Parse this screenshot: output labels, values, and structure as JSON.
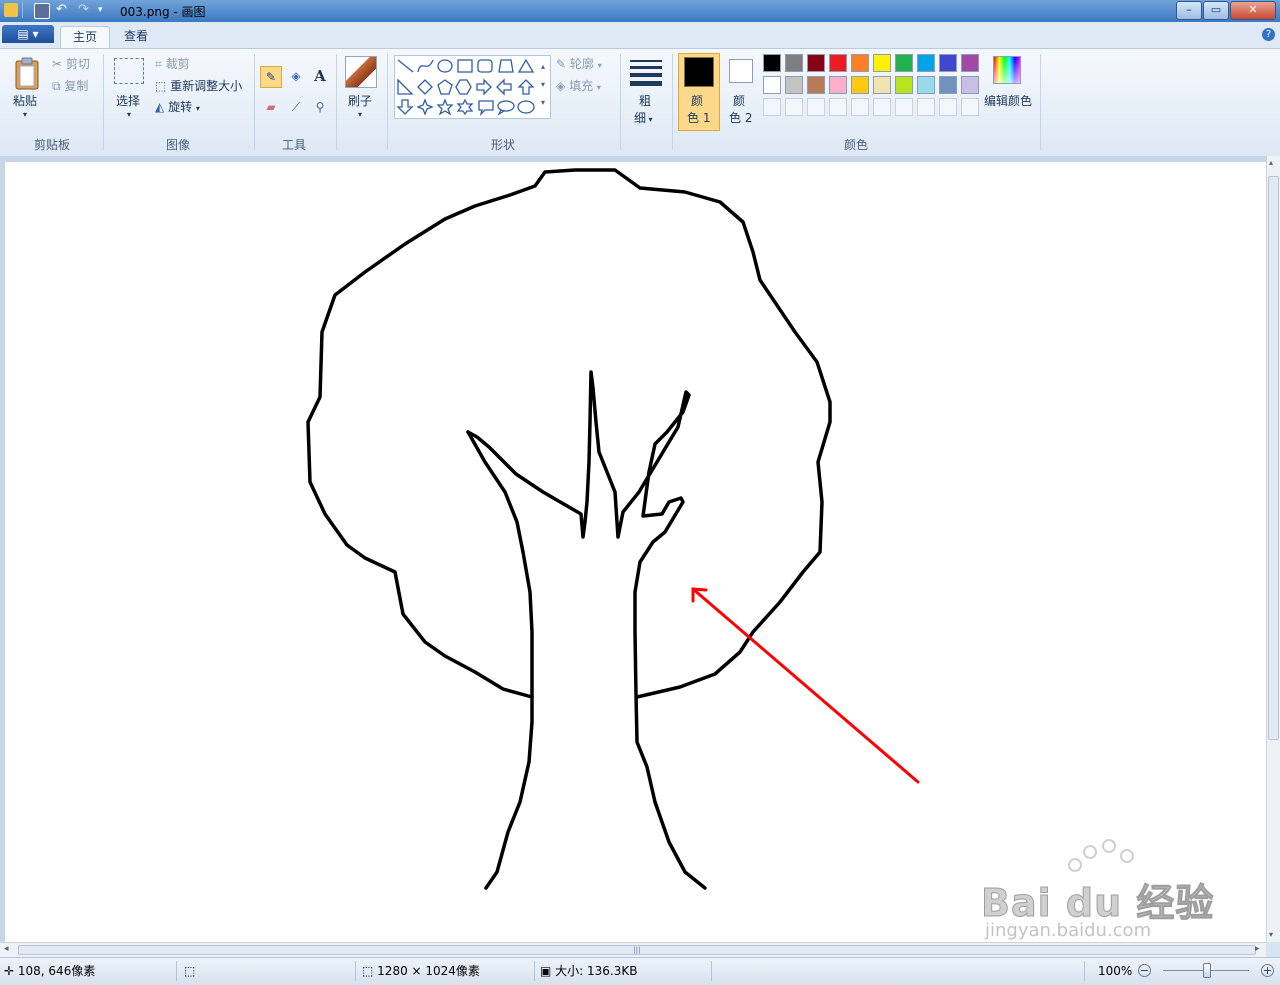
{
  "window": {
    "title": "003.png - 画图",
    "controls": [
      "minimize",
      "maximize",
      "close"
    ]
  },
  "tabs": {
    "home": "主页",
    "view": "查看"
  },
  "ribbon": {
    "clipboard": {
      "paste": "粘贴",
      "cut": "剪切",
      "copy": "复制",
      "group": "剪贴板"
    },
    "image": {
      "select": "选择",
      "crop": "裁剪",
      "resize": "重新调整大小",
      "rotate": "旋转",
      "group": "图像"
    },
    "tools": {
      "group": "工具"
    },
    "brush": {
      "label": "刷子"
    },
    "shapes": {
      "outline": "轮廓",
      "fill": "填充",
      "group": "形状"
    },
    "size": {
      "line1": "粗",
      "line2": "细"
    },
    "colors": {
      "color1_a": "颜",
      "color1_b": "色 1",
      "color2_a": "颜",
      "color2_b": "色 2",
      "edit": "编辑颜色",
      "group": "颜色",
      "color1_value": "#000000",
      "color2_value": "#ffffff",
      "palette_row1": [
        "#000000",
        "#7f7f7f",
        "#880015",
        "#ed1c24",
        "#ff7f27",
        "#fff200",
        "#22b14c",
        "#00a2e8",
        "#3f48cc",
        "#a349a4"
      ],
      "palette_row2": [
        "#ffffff",
        "#c3c3c3",
        "#b97a57",
        "#ffaec9",
        "#ffc90e",
        "#efe4b0",
        "#b5e61d",
        "#99d9ea",
        "#7092be",
        "#c8bfe7"
      ]
    }
  },
  "statusbar": {
    "cursor": "108, 646像素",
    "canvas_size": "1280 × 1024像素",
    "file_size": "大小: 136.3KB",
    "zoom": "100%"
  },
  "watermark": {
    "line1": "Bai du 经验",
    "line2": "jingyan.baidu.com"
  }
}
